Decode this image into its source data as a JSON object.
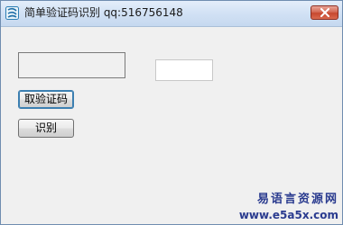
{
  "window": {
    "title": "简单验证码识别  qq:516756148",
    "icon": "app-swirl-icon",
    "close_icon": "close-icon"
  },
  "form": {
    "code_input_value": "",
    "get_captcha_label": "取验证码",
    "recognize_label": "识别"
  },
  "watermark": {
    "line1": "易语言资源网",
    "line2": "www.e5a5x.com"
  },
  "colors": {
    "title_gradient_top": "#e4eefa",
    "close_button": "#c7472f",
    "watermark": "#2a3b8f"
  }
}
